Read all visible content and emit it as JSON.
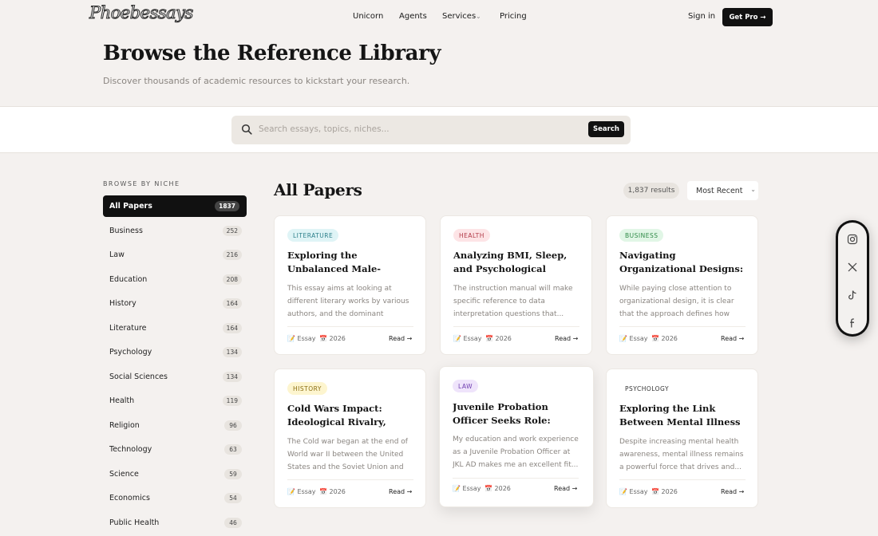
{
  "nav": {
    "logo": "Phoebessays",
    "links": [
      "Unicorn",
      "Agents",
      "Services",
      "Pricing"
    ],
    "signin": "Sign in",
    "cta": "Get Pro →"
  },
  "hero": {
    "title": "Browse the Reference Library",
    "subtitle": "Discover thousands of academic resources to kickstart your research."
  },
  "search": {
    "placeholder": "Search essays, topics, niches...",
    "button": "Search"
  },
  "sidebar": {
    "heading": "BROWSE BY NICHE",
    "items": [
      {
        "label": "All Papers",
        "count": "1837"
      },
      {
        "label": "Business",
        "count": "252"
      },
      {
        "label": "Law",
        "count": "216"
      },
      {
        "label": "Education",
        "count": "208"
      },
      {
        "label": "History",
        "count": "164"
      },
      {
        "label": "Literature",
        "count": "164"
      },
      {
        "label": "Psychology",
        "count": "134"
      },
      {
        "label": "Social Sciences",
        "count": "134"
      },
      {
        "label": "Health",
        "count": "119"
      },
      {
        "label": "Religion",
        "count": "96"
      },
      {
        "label": "Technology",
        "count": "63"
      },
      {
        "label": "Science",
        "count": "59"
      },
      {
        "label": "Economics",
        "count": "54"
      },
      {
        "label": "Public Health",
        "count": "46"
      }
    ]
  },
  "main": {
    "title": "All Papers",
    "results": "1,837 results",
    "sort": "Most Recent"
  },
  "cards": [
    {
      "tag": "LITERATURE",
      "tag_bg": "#dff4f6",
      "tag_color": "#2c7f8a",
      "title": "Exploring the Unbalanced Male-Female Dynamic in...",
      "excerpt": "This essay aims at looking at different literary works by various authors, and the dominant theme...",
      "type": "Essay",
      "year": "2026",
      "read": "Read →"
    },
    {
      "tag": "HEALTH",
      "tag_bg": "#fde4e6",
      "tag_color": "#b23a48",
      "title": "Analyzing BMI, Sleep, and Psychological Health in...",
      "excerpt": "The instruction manual will make specific reference to data interpretation questions that...",
      "type": "Essay",
      "year": "2026",
      "read": "Read →"
    },
    {
      "tag": "BUSINESS",
      "tag_bg": "#e1f6e6",
      "tag_color": "#2f8a47",
      "title": "Navigating Organizational Designs: Aligning...",
      "excerpt": "While paying close attention to organizational design, it is clear that the approach defines how an...",
      "type": "Essay",
      "year": "2026",
      "read": "Read →"
    },
    {
      "tag": "HISTORY",
      "tag_bg": "#fdf5cf",
      "tag_color": "#8a6d12",
      "title": "Cold Wars Impact: Ideological Rivalry, Atomi...",
      "excerpt": "The Cold war began at the end of World war II between the United States and the Soviet Union and it...",
      "type": "Essay",
      "year": "2026",
      "read": "Read →"
    },
    {
      "tag": "LAW",
      "tag_bg": "#efe4fb",
      "tag_color": "#6f3fb0",
      "title": "Juvenile Probation Officer Seeks Role: Driven...",
      "excerpt": "My education and work experience as a Juvenile Probation Officer at JKL AD makes me an excellent fit...",
      "type": "Essay",
      "year": "2026",
      "read": "Read →"
    },
    {
      "tag": "PSYCHOLOGY",
      "tag_bg": "#ffffff",
      "tag_color": "#333333",
      "title": "Exploring the Link Between Mental Illness a...",
      "excerpt": "Despite increasing mental health awareness, mental illness remains a powerful force that drives and...",
      "type": "Essay",
      "year": "2026",
      "read": "Read →"
    }
  ],
  "social": [
    "instagram-icon",
    "x-icon",
    "tiktok-icon",
    "facebook-icon"
  ]
}
